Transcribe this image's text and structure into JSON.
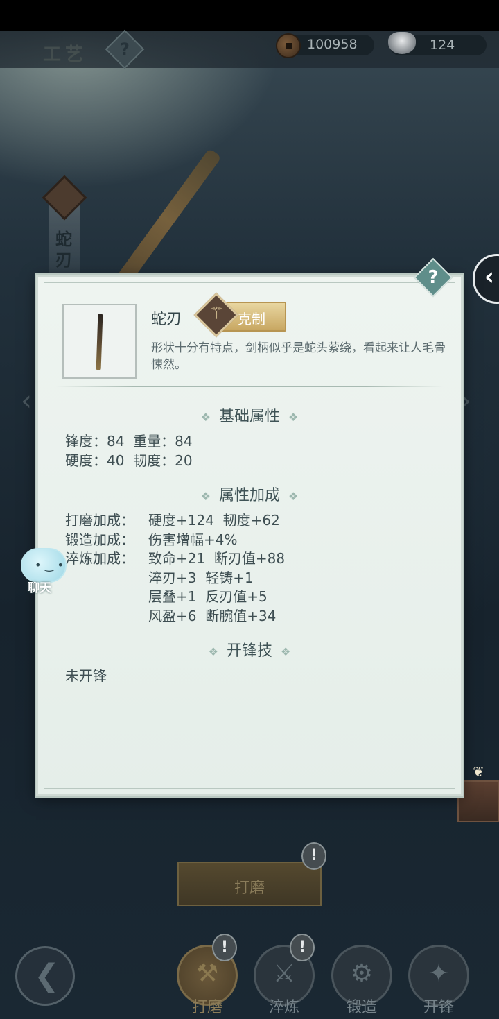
{
  "header": {
    "title": "工艺",
    "help_glyph": "?",
    "coins": "100958",
    "silver": "124"
  },
  "side": {
    "weapon_tab_text": "蛇刃",
    "expand_arrow": "‹",
    "prev_arrow": "‹",
    "next_arrow": "›"
  },
  "item": {
    "name": "蛇刃",
    "badge": "克制",
    "description": "形状十分有特点，剑柄似乎是蛇头萦绕，看起来让人毛骨悚然。",
    "help_glyph": "?"
  },
  "sections": {
    "base_title": "基础属性",
    "bonus_title": "属性加成",
    "skill_title": "开锋技",
    "deco": "❖"
  },
  "base_stats": {
    "line1": "锋度：84  重量：84",
    "line2": "硬度：40  韧度：20"
  },
  "bonuses": {
    "grind_label": "打磨加成：",
    "grind_value": "硬度+124  韧度+62",
    "forge_label": "锻造加成：",
    "forge_value": "伤害增幅+4%",
    "temper_label": "淬炼加成：",
    "temper_lines": [
      "致命+21  断刃值+88",
      "淬刃+3  轻铸+1",
      "层叠+1  反刃值+5",
      "风盈+6  断腕值+34"
    ]
  },
  "skill": {
    "status": "未开锋"
  },
  "chat": {
    "label": "聊天",
    "face": "• ‿ •"
  },
  "actions": {
    "grind_button": "打磨",
    "alert_glyph": "!",
    "back_glyph": "❮"
  },
  "toolbar": [
    {
      "label": "打磨",
      "glyph": "⚒"
    },
    {
      "label": "淬炼",
      "glyph": "⚔"
    },
    {
      "label": "锻造",
      "glyph": "⚙"
    },
    {
      "label": "开锋",
      "glyph": "✦"
    }
  ]
}
